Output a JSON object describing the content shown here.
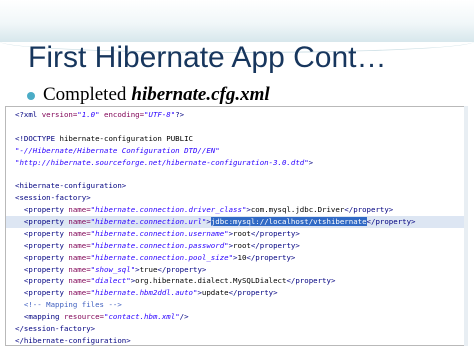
{
  "title": "First Hibernate App Cont…",
  "bullet": {
    "text": "Completed",
    "emphasis": "hibernate.cfg.xml"
  },
  "code": [
    "<?xml version=\"1.0\" encoding=\"UTF-8\"?>",
    "",
    "<!DOCTYPE hibernate-configuration PUBLIC",
    "\"-//Hibernate/Hibernate Configuration DTD//EN\"",
    "\"http://hibernate.sourceforge.net/hibernate-configuration-3.0.dtd\">",
    "",
    "<hibernate-configuration>",
    "<session-factory>",
    "  <property name=\"hibernate.connection.driver_class\">com.mysql.jdbc.Driver</property>",
    "  <property name=\"hibernate.connection.url\">jdbc:mysql://localhost/vtshibernate</property>",
    "  <property name=\"hibernate.connection.username\">root</property>",
    "  <property name=\"hibernate.connection.password\">root</property>",
    "  <property name=\"hibernate.connection.pool_size\">10</property>",
    "  <property name=\"show_sql\">true</property>",
    "  <property name=\"dialect\">org.hibernate.dialect.MySQLDialect</property>",
    "  <property name=\"hibernate.hbm2ddl.auto\">update</property>",
    "  <!-- Mapping files -->",
    "  <mapping resource=\"contact.hbm.xml\"/>",
    "</session-factory>",
    "</hibernate-configuration>"
  ],
  "highlighted_line": 9,
  "selected_text": "jdbc:mysql://localhost/vtshibernate"
}
